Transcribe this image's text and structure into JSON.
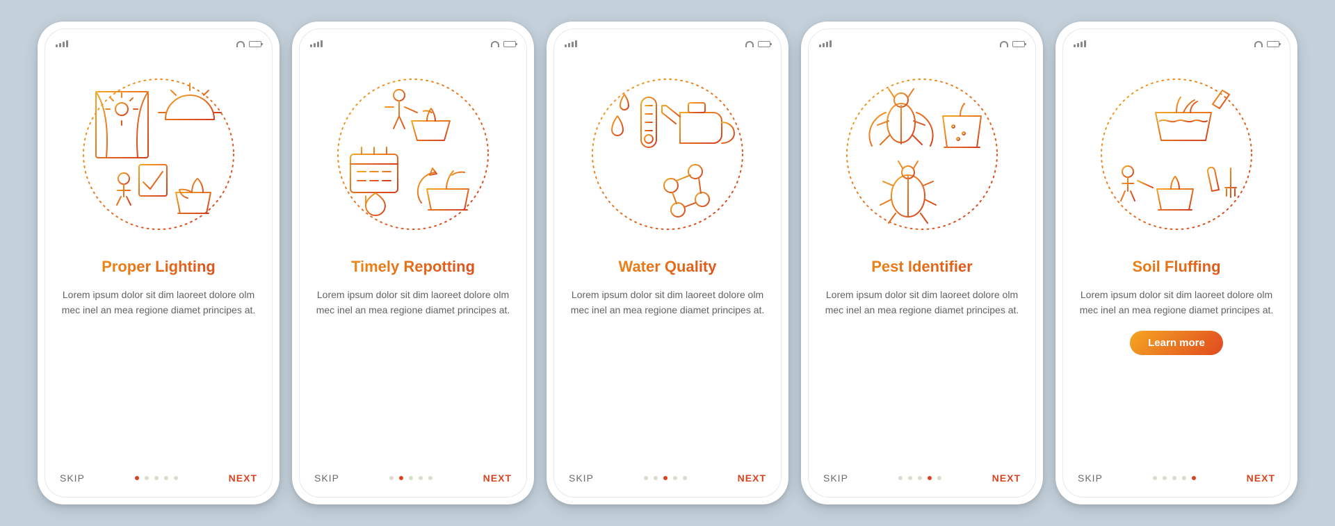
{
  "common": {
    "skip_label": "SKIP",
    "next_label": "NEXT",
    "learn_more_label": "Learn more",
    "body_text": "Lorem ipsum dolor sit dim laoreet dolore olm mec inel an mea regione diamet principes at.",
    "total_steps": 5,
    "colors": {
      "grad_from": "#f39c12",
      "grad_to": "#d63d1f",
      "bg": "#c4d1db"
    }
  },
  "screens": [
    {
      "title": "Proper Lighting",
      "icon": "lighting-icon",
      "step": 0,
      "has_cta": false
    },
    {
      "title": "Timely Repotting",
      "icon": "repotting-icon",
      "step": 1,
      "has_cta": false
    },
    {
      "title": "Water Quality",
      "icon": "water-icon",
      "step": 2,
      "has_cta": false
    },
    {
      "title": "Pest Identifier",
      "icon": "pest-icon",
      "step": 3,
      "has_cta": false
    },
    {
      "title": "Soil Fluffing",
      "icon": "soil-icon",
      "step": 4,
      "has_cta": true
    }
  ]
}
